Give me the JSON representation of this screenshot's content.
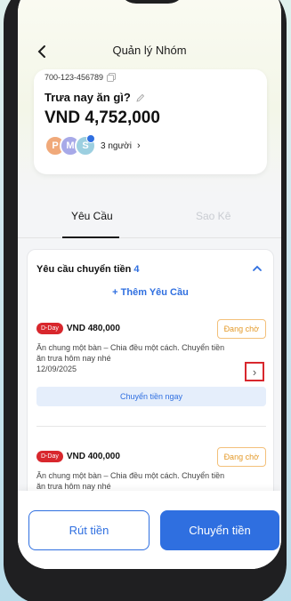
{
  "header": {
    "title": "Quản lý Nhóm"
  },
  "group": {
    "account_number": "700-123-456789",
    "name": "Trưa nay ăn gì?",
    "balance": "VND 4,752,000",
    "avatars": [
      "P",
      "M",
      "S"
    ],
    "member_count": "3 người"
  },
  "tabs": [
    {
      "label": "Yêu Cầu",
      "active": true
    },
    {
      "label": "Sao Kê",
      "active": false
    }
  ],
  "requests_section": {
    "title": "Yêu cầu chuyển tiền",
    "count": "4",
    "add_label": "+ Thêm Yêu Cầu"
  },
  "requests": [
    {
      "badge": "D-Day",
      "amount": "VND 480,000",
      "status": "Đang chờ",
      "description": "Ăn chung một bàn – Chia đều một cách. Chuyển tiền ăn trưa hôm nay nhé",
      "date": "12/09/2025",
      "action_label": "Chuyển tiền ngay"
    },
    {
      "badge": "D-Day",
      "amount": "VND 400,000",
      "status": "Đang chờ",
      "description": "Ăn chung một bàn – Chia đều một cách. Chuyển tiền ăn trưa hôm nay nhé"
    }
  ],
  "footer": {
    "withdraw_label": "Rút tiền",
    "transfer_label": "Chuyển tiền"
  },
  "colors": {
    "accent": "#2f6fe0",
    "dday": "#d8272d",
    "pending": "#e49a2a"
  }
}
